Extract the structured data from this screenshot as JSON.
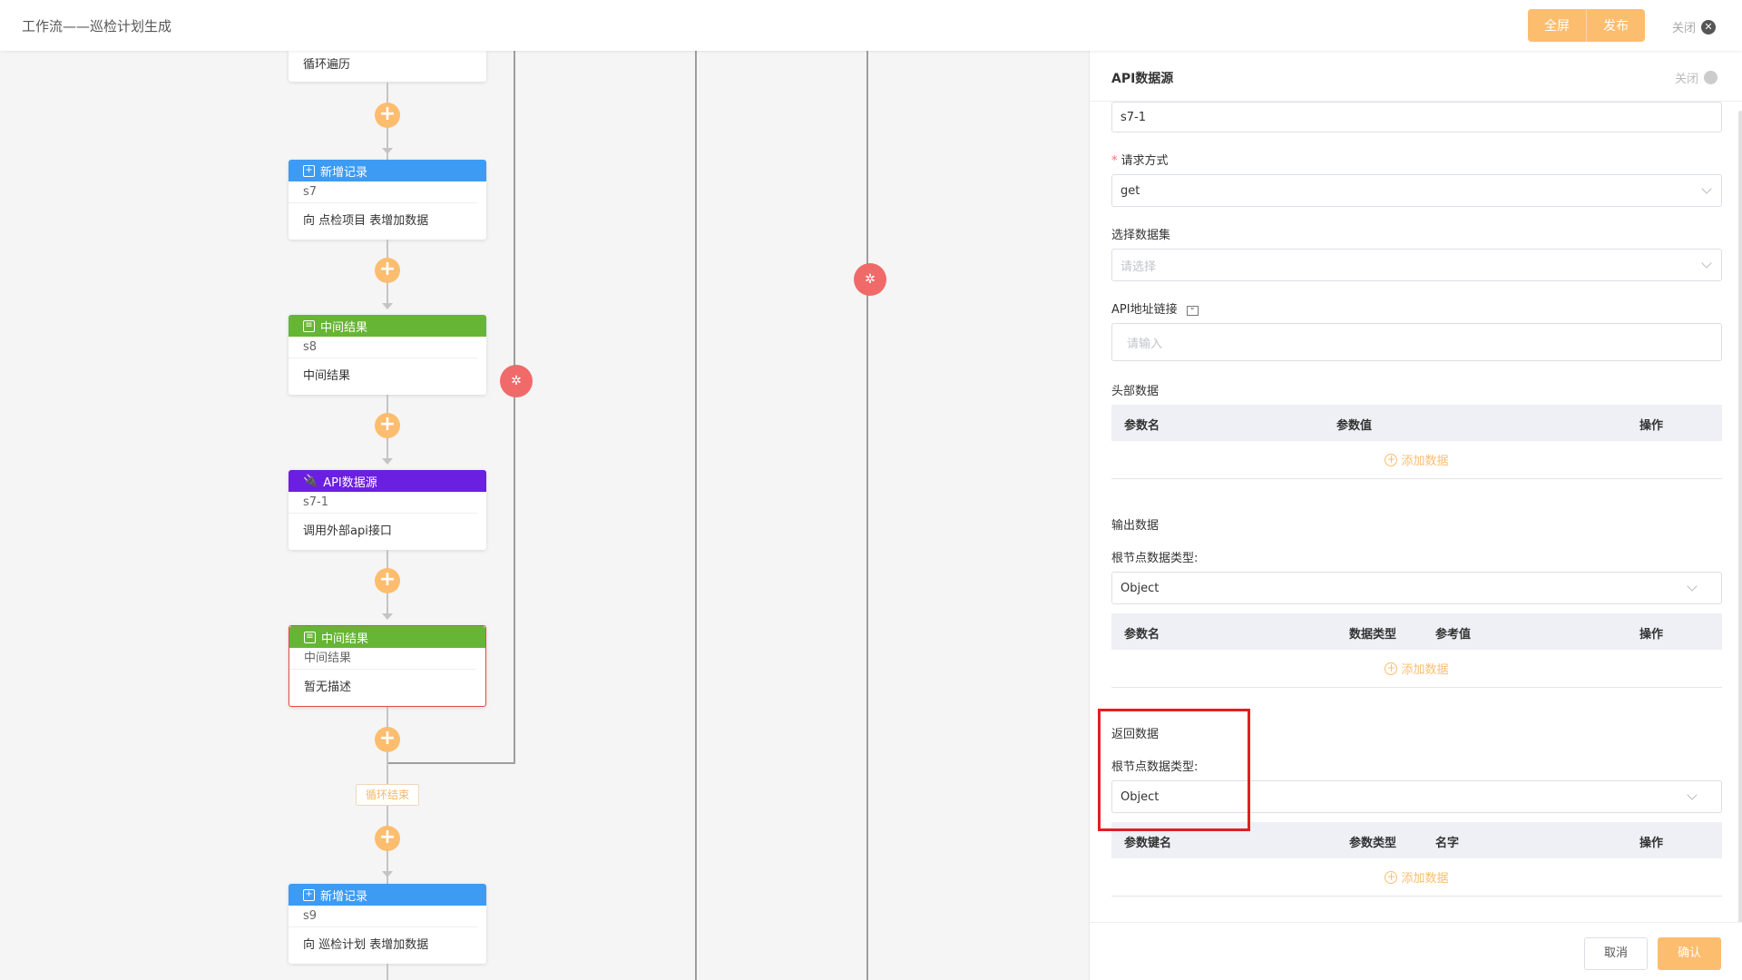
{
  "header": {
    "title": "工作流——巡检计划生成",
    "fullscreen_label": "全屏",
    "publish_label": "发布",
    "close_label": "关闭"
  },
  "canvas": {
    "loop_top_text": "循环遍历",
    "nodes": [
      {
        "type": "新增记录",
        "code": "s7",
        "desc": "向 点检项目 表增加数据",
        "color": "#3e9bf3",
        "icon": "add-record-icon"
      },
      {
        "type": "中间结果",
        "code": "s8",
        "desc": "中间结果",
        "color": "#67b535",
        "icon": "database-icon"
      },
      {
        "type": "API数据源",
        "code": "s7-1",
        "desc": "调用外部api接口",
        "color": "#6b1fe0",
        "icon": "plug-icon"
      },
      {
        "type": "中间结果",
        "code": "中间结果",
        "desc": "暂无描述",
        "color": "#67b535",
        "icon": "database-icon"
      },
      {
        "type": "新增记录",
        "code": "s9",
        "desc": "向 巡检计划 表增加数据",
        "color": "#3e9bf3",
        "icon": "add-record-icon"
      }
    ],
    "loop_end_label": "循环结束"
  },
  "panel": {
    "title": "API数据源",
    "close_label": "关闭",
    "name_value": "s7-1",
    "method_label": "请求方式",
    "method_value": "get",
    "dataset_label": "选择数据集",
    "dataset_placeholder": "请选择",
    "api_url_label": "API地址链接",
    "api_url_placeholder": "请输入",
    "header_section": "头部数据",
    "header_cols": [
      "参数名",
      "参数值",
      "操作"
    ],
    "add_data_label": "添加数据",
    "output_section": "输出数据",
    "root_type_label": "根节点数据类型:",
    "output_root_value": "Object",
    "output_cols": [
      "参数名",
      "数据类型",
      "参考值",
      "操作"
    ],
    "return_section": "返回数据",
    "return_root_value": "Object",
    "return_cols": [
      "参数键名",
      "参数类型",
      "名字",
      "操作"
    ],
    "cancel_label": "取消",
    "confirm_label": "确认"
  },
  "colors": {
    "accent": "#fdbd6e",
    "highlight": "#e02020",
    "error_circle": "#f06a6a"
  }
}
